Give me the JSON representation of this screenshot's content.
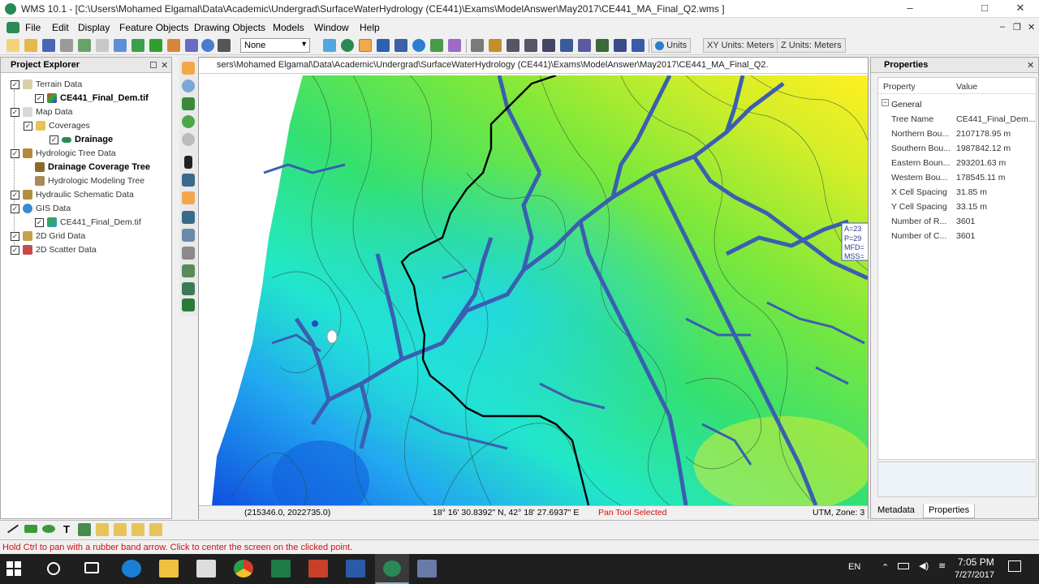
{
  "window": {
    "title": "WMS 10.1 - [C:\\Users\\Mohamed Elgamal\\Data\\Academic\\Undergrad\\SurfaceWaterHydrology (CE441)\\Exams\\ModelAnswer\\May2017\\CE441_MA_Final_Q2.wms ]",
    "minimize": "–",
    "maximize": "□",
    "close": "✕",
    "mdi_minimize": "–",
    "mdi_restore": "❐",
    "mdi_close": "✕"
  },
  "menu": [
    "File",
    "Edit",
    "Display",
    "Feature Objects",
    "Drawing Objects",
    "Models",
    "Window",
    "Help"
  ],
  "toolbar": {
    "select_value": "None",
    "units_label": "Units",
    "xy_units": "XY Units: Meters",
    "z_units": "Z Units: Meters"
  },
  "project_explorer": {
    "title": "Project Explorer",
    "close": "✕",
    "items": [
      {
        "label": "Terrain Data",
        "bold": false
      },
      {
        "label": "CE441_Final_Dem.tif",
        "bold": true
      },
      {
        "label": "Map Data",
        "bold": false
      },
      {
        "label": "Coverages",
        "bold": false
      },
      {
        "label": "Drainage",
        "bold": true
      },
      {
        "label": "Hydrologic Tree Data",
        "bold": false
      },
      {
        "label": "Drainage Coverage Tree",
        "bold": true
      },
      {
        "label": "Hydrologic Modeling Tree",
        "bold": false
      },
      {
        "label": "Hydraulic Schematic Data",
        "bold": false
      },
      {
        "label": "GIS Data",
        "bold": false
      },
      {
        "label": "CE441_Final_Dem.tif",
        "bold": false
      },
      {
        "label": "2D Grid Data",
        "bold": false
      },
      {
        "label": "2D Scatter Data",
        "bold": false
      }
    ]
  },
  "map": {
    "path": "sers\\Mohamed Elgamal\\Data\\Academic\\Undergrad\\SurfaceWaterHydrology (CE441)\\Exams\\ModelAnswer\\May2017\\CE441_MA_Final_Q2.",
    "labels": [
      "A=23",
      "P=29",
      "MFD=",
      "MSS="
    ],
    "status": {
      "coords": "(215346.0, 2022735.0)",
      "latlon": "18° 16' 30.8392\" N, 42° 18' 27.6937\" E",
      "tool": "Pan Tool Selected",
      "projection": "UTM, Zone: 3"
    }
  },
  "properties": {
    "title": "Properties",
    "close": "✕",
    "col_property": "Property",
    "col_value": "Value",
    "group": "General",
    "group_toggle": "−",
    "rows": [
      {
        "k": "Tree Name",
        "v": "CE441_Final_Dem..."
      },
      {
        "k": "Northern Bou...",
        "v": "2107178.95 m"
      },
      {
        "k": "Southern Bou...",
        "v": "1987842.12 m"
      },
      {
        "k": "Eastern Boun...",
        "v": "293201.63 m"
      },
      {
        "k": "Western Bou...",
        "v": "178545.11 m"
      },
      {
        "k": "X Cell Spacing",
        "v": "31.85 m"
      },
      {
        "k": "Y Cell Spacing",
        "v": "33.15 m"
      },
      {
        "k": "Number of R...",
        "v": "3601"
      },
      {
        "k": "Number of C...",
        "v": "3601"
      }
    ],
    "tabs": [
      "Metadata",
      "Properties"
    ]
  },
  "statusbar": {
    "hint": "Hold Ctrl to pan with a rubber band arrow.  Click to center the screen on the clicked point."
  },
  "taskbar": {
    "lang": "EN",
    "time": "7:05 PM",
    "date": "7/27/2017"
  },
  "colors": {
    "accent_green": "#2a8a55",
    "status_red": "#d01010",
    "taskbar_bg": "#1f1f1f",
    "stream_blue": "#3a5fb0"
  }
}
